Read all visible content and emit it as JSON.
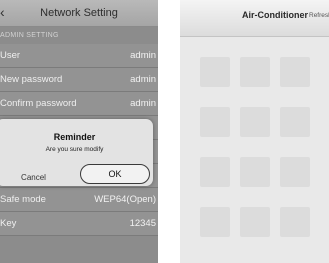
{
  "left_screen": {
    "title": "Network Setting",
    "section_label": "ADMIN SETTING",
    "rows": [
      {
        "label": "User",
        "value": "admin"
      },
      {
        "label": "New password",
        "value": "admin"
      },
      {
        "label": "Confirm password",
        "value": "admin"
      },
      {
        "label": "Safe mode",
        "value": "WEP64(Open)"
      },
      {
        "label": "Key",
        "value": "12345"
      }
    ],
    "dialog": {
      "title": "Reminder",
      "message": "Are you sure modify",
      "cancel": "Cancel",
      "ok": "OK"
    }
  },
  "right_screen": {
    "title": "Air-Conditioner",
    "refresh": "Refresh"
  },
  "colors": {
    "left_background": "#8c8c8c",
    "dialog_background": "#e3e3e3",
    "right_background": "#e9e9e9"
  },
  "icons": [
    "back-arrow-icon"
  ]
}
